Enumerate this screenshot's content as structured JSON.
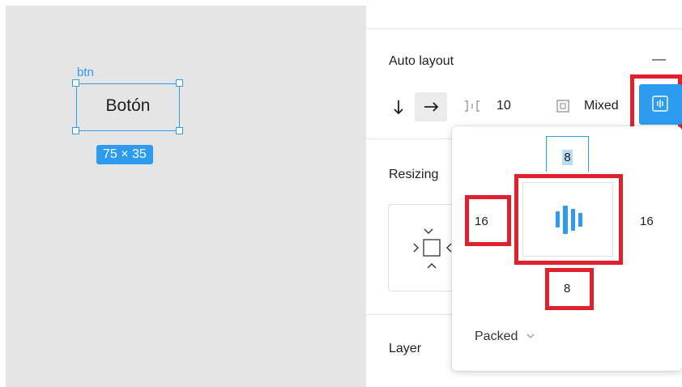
{
  "canvas": {
    "layer_name": "btn",
    "button_text": "Botón",
    "size_badge": "75 × 35"
  },
  "panel": {
    "auto_layout_title": "Auto layout",
    "remove_symbol": "—",
    "spacing_value": "10",
    "padding_value": "Mixed",
    "resizing_title": "Resizing",
    "layer_title": "Layer"
  },
  "popover": {
    "padding_top": "8",
    "padding_left": "16",
    "padding_right": "16",
    "padding_bottom": "8",
    "distribution": "Packed"
  },
  "colors": {
    "accent": "#2d9cf0",
    "highlight": "#e0202a"
  }
}
